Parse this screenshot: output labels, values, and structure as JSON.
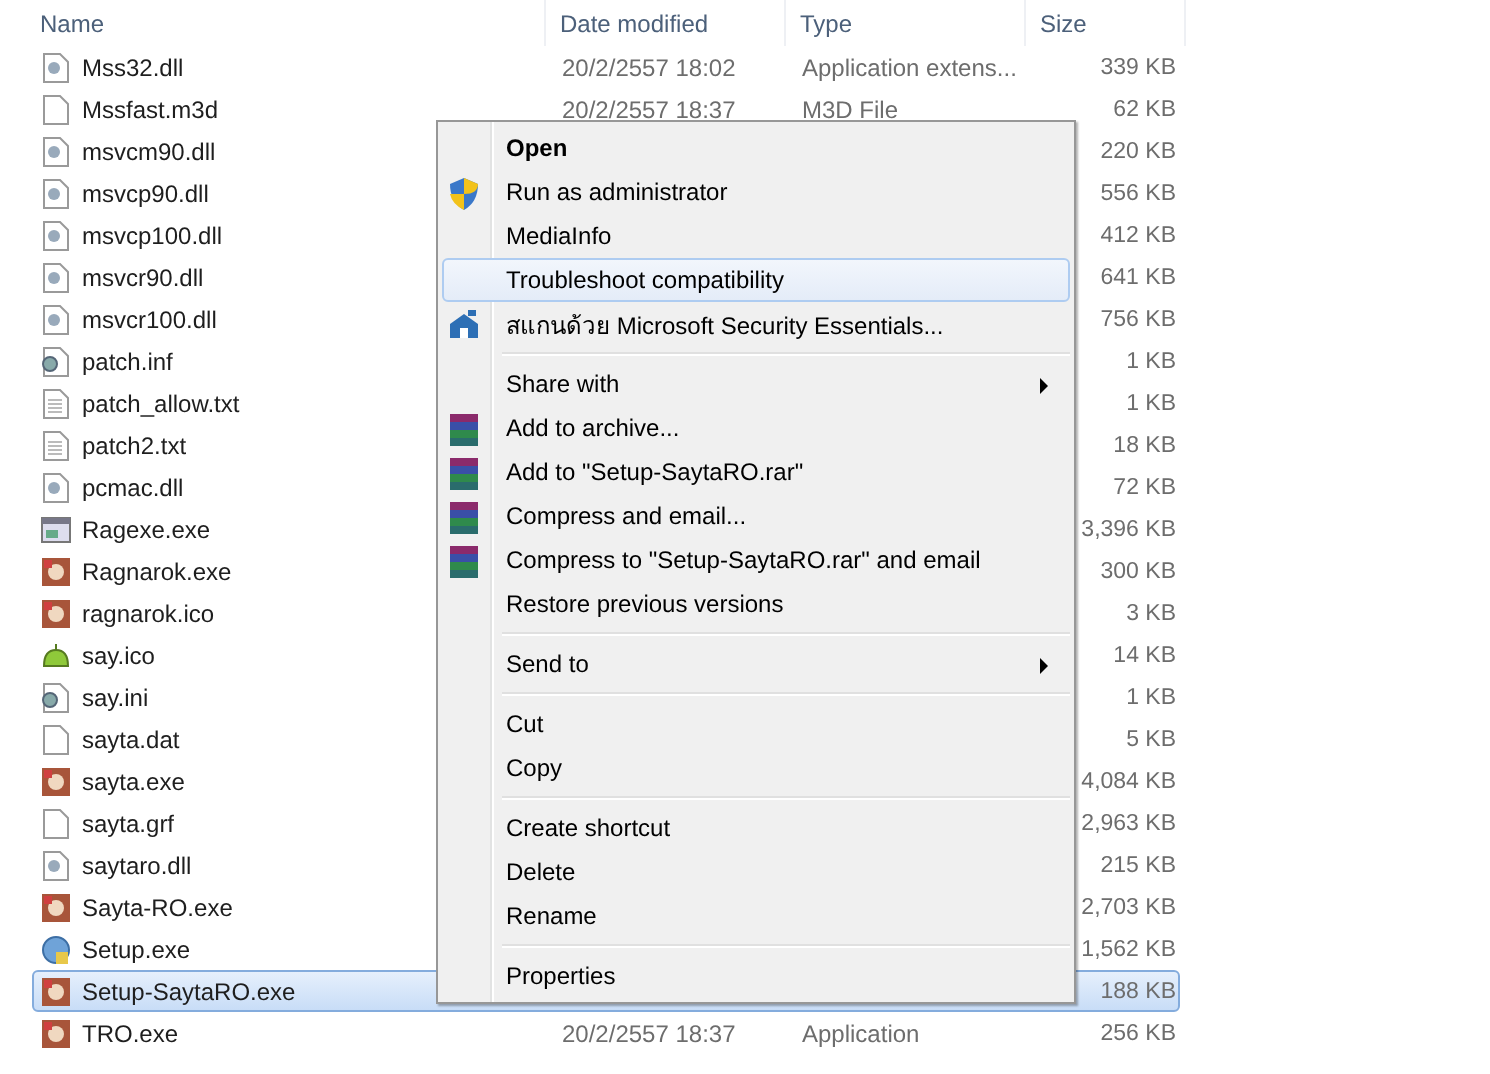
{
  "columns": [
    "Name",
    "Date modified",
    "Type",
    "Size"
  ],
  "files": [
    {
      "name": "Mss32.dll",
      "kind": "dll",
      "date": "20/2/2557 18:02",
      "type": "Application extens...",
      "size": "339 KB",
      "selected": false
    },
    {
      "name": "Mssfast.m3d",
      "kind": "blank",
      "date": "20/2/2557 18:37",
      "type": "M3D File",
      "size": "62 KB",
      "selected": false
    },
    {
      "name": "msvcm90.dll",
      "kind": "dll",
      "size": "220 KB",
      "selected": false
    },
    {
      "name": "msvcp90.dll",
      "kind": "dll",
      "size": "556 KB",
      "selected": false
    },
    {
      "name": "msvcp100.dll",
      "kind": "dll",
      "size": "412 KB",
      "selected": false
    },
    {
      "name": "msvcr90.dll",
      "kind": "dll",
      "size": "641 KB",
      "selected": false
    },
    {
      "name": "msvcr100.dll",
      "kind": "dll",
      "size": "756 KB",
      "selected": false
    },
    {
      "name": "patch.inf",
      "kind": "config",
      "size": "1 KB",
      "selected": false
    },
    {
      "name": "patch_allow.txt",
      "kind": "text",
      "size": "1 KB",
      "selected": false
    },
    {
      "name": "patch2.txt",
      "kind": "text",
      "size": "18 KB",
      "selected": false
    },
    {
      "name": "pcmac.dll",
      "kind": "dll",
      "size": "72 KB",
      "selected": false
    },
    {
      "name": "Ragexe.exe",
      "kind": "app",
      "size": "3,396 KB",
      "selected": false
    },
    {
      "name": "Ragnarok.exe",
      "kind": "game",
      "size": "300 KB",
      "selected": false
    },
    {
      "name": "ragnarok.ico",
      "kind": "game",
      "size": "3 KB",
      "selected": false
    },
    {
      "name": "say.ico",
      "kind": "slime",
      "size": "14 KB",
      "selected": false
    },
    {
      "name": "say.ini",
      "kind": "config",
      "size": "1 KB",
      "selected": false
    },
    {
      "name": "sayta.dat",
      "kind": "blank",
      "size": "5 KB",
      "selected": false
    },
    {
      "name": "sayta.exe",
      "kind": "game",
      "size": "4,084 KB",
      "selected": false
    },
    {
      "name": "sayta.grf",
      "kind": "blank",
      "size": "2,963 KB",
      "selected": false
    },
    {
      "name": "saytaro.dll",
      "kind": "dll",
      "size": "215 KB",
      "selected": false
    },
    {
      "name": "Sayta-RO.exe",
      "kind": "game",
      "size": "2,703 KB",
      "selected": false
    },
    {
      "name": "Setup.exe",
      "kind": "setup",
      "size": "1,562 KB",
      "selected": false
    },
    {
      "name": "Setup-SaytaRO.exe",
      "kind": "game",
      "size": "188 KB",
      "selected": true
    },
    {
      "name": "TRO.exe",
      "kind": "game",
      "date": "20/2/2557 18:37",
      "type": "Application",
      "size": "256 KB",
      "selected": false
    }
  ],
  "context_menu": [
    {
      "kind": "item",
      "label": "Open",
      "default": true,
      "highlighted": false,
      "submenu": false
    },
    {
      "kind": "shield",
      "label": "Run as administrator",
      "default": false,
      "highlighted": false,
      "submenu": false
    },
    {
      "kind": "item",
      "label": "MediaInfo",
      "default": false,
      "highlighted": false,
      "submenu": false
    },
    {
      "kind": "item",
      "label": "Troubleshoot compatibility",
      "default": false,
      "highlighted": true,
      "submenu": false
    },
    {
      "kind": "house",
      "label": "สแกนด้วย Microsoft Security Essentials...",
      "default": false,
      "highlighted": false,
      "submenu": false
    },
    {
      "kind": "separator"
    },
    {
      "kind": "item",
      "label": "Share with",
      "default": false,
      "highlighted": false,
      "submenu": true
    },
    {
      "kind": "archive",
      "label": "Add to archive...",
      "default": false,
      "highlighted": false,
      "submenu": false
    },
    {
      "kind": "archive",
      "label": "Add to \"Setup-SaytaRO.rar\"",
      "default": false,
      "highlighted": false,
      "submenu": false
    },
    {
      "kind": "archive",
      "label": "Compress and email...",
      "default": false,
      "highlighted": false,
      "submenu": false
    },
    {
      "kind": "archive",
      "label": "Compress to \"Setup-SaytaRO.rar\" and email",
      "default": false,
      "highlighted": false,
      "submenu": false
    },
    {
      "kind": "item",
      "label": "Restore previous versions",
      "default": false,
      "highlighted": false,
      "submenu": false
    },
    {
      "kind": "separator"
    },
    {
      "kind": "item",
      "label": "Send to",
      "default": false,
      "highlighted": false,
      "submenu": true
    },
    {
      "kind": "separator"
    },
    {
      "kind": "item",
      "label": "Cut",
      "default": false,
      "highlighted": false,
      "submenu": false
    },
    {
      "kind": "item",
      "label": "Copy",
      "default": false,
      "highlighted": false,
      "submenu": false
    },
    {
      "kind": "separator"
    },
    {
      "kind": "item",
      "label": "Create shortcut",
      "default": false,
      "highlighted": false,
      "submenu": false
    },
    {
      "kind": "item",
      "label": "Delete",
      "default": false,
      "highlighted": false,
      "submenu": false
    },
    {
      "kind": "item",
      "label": "Rename",
      "default": false,
      "highlighted": false,
      "submenu": false
    },
    {
      "kind": "separator"
    },
    {
      "kind": "item",
      "label": "Properties",
      "default": false,
      "highlighted": false,
      "submenu": false
    }
  ]
}
